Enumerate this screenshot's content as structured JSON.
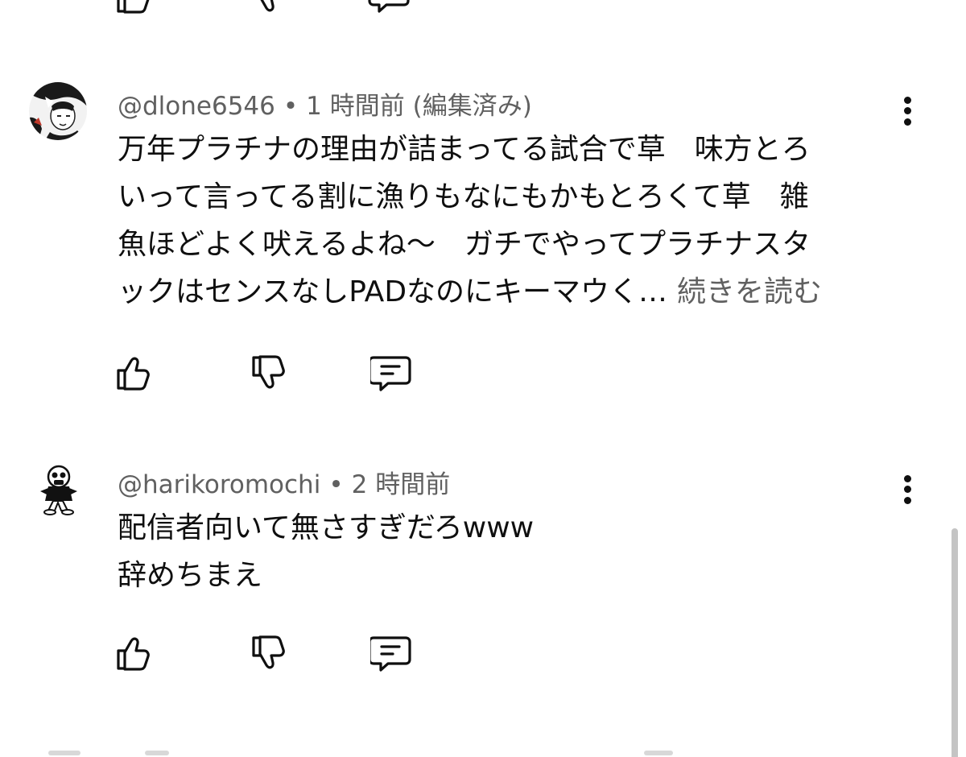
{
  "comments": [
    {
      "handle": "@dlone6546",
      "time": "1 時間前 (編集済み)",
      "lines": [
        "万年プラチナの理由が詰まってる試合で草　味方とろ",
        "いって言ってる割に漁りもなにもかもとろくて草　雑",
        "魚ほどよく吠えるよね〜　ガチでやってプラチナスタ",
        "ックはセンスなしPADなのにキーマウく…"
      ],
      "more": "続きを読む"
    },
    {
      "handle": "@harikoromochi",
      "time": "2 時間前",
      "lines": [
        "配信者向いて無さすぎだろwww",
        "辞めちまえ"
      ]
    }
  ],
  "separator": "•",
  "icons": {
    "like": "thumbs-up-icon",
    "dislike": "thumbs-down-icon",
    "reply": "reply-comment-icon",
    "menu": "more-vertical-icon"
  },
  "colors": {
    "text": "#0f0f0f",
    "meta": "#606060",
    "background": "#ffffff"
  }
}
